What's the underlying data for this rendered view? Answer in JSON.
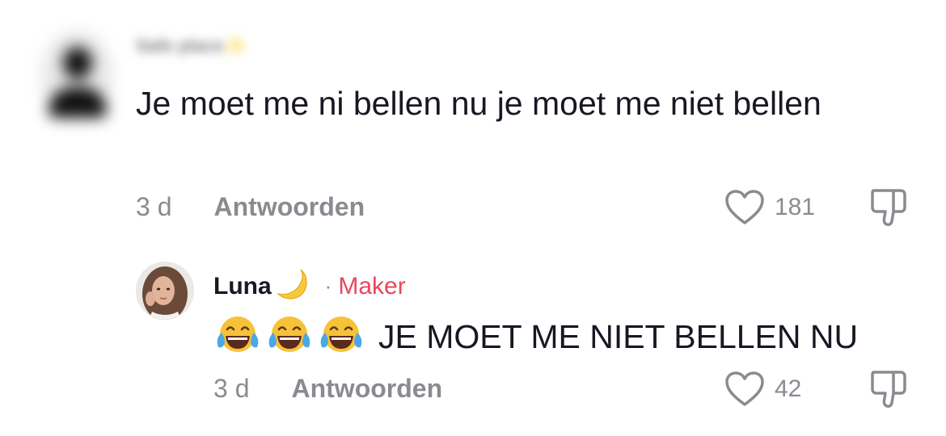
{
  "comments": [
    {
      "username": "Safe place",
      "username_decoration": "✨",
      "avatar_icon": "default-avatar-icon",
      "text": "Je moet me ni bellen nu je moet me niet bellen",
      "time": "3 d",
      "reply_label": "Antwoorden",
      "likes": "181",
      "like_icon": "heart-outline-icon",
      "dislike_icon": "thumbs-down-icon"
    }
  ],
  "reply": {
    "username": "Luna",
    "username_icon": "crescent-moon-icon",
    "separator": "·",
    "badge": "Maker",
    "emojis": [
      "face-with-tears-of-joy-icon",
      "face-with-tears-of-joy-icon",
      "face-with-tears-of-joy-icon"
    ],
    "text": "JE MOET ME NIET BELLEN NU",
    "time": "3 d",
    "reply_label": "Antwoorden",
    "likes": "42",
    "like_icon": "heart-outline-icon",
    "dislike_icon": "thumbs-down-icon"
  },
  "colors": {
    "text_primary": "#161823",
    "text_secondary": "#8a8b91",
    "maker_badge": "#e8475e",
    "background": "#ffffff"
  }
}
